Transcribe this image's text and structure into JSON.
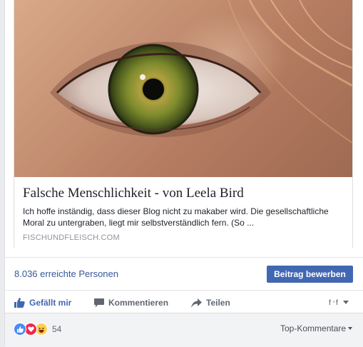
{
  "link_card": {
    "title": "Falsche Menschlichkeit - von Leela Bird",
    "description": "Ich hoffe inständig, dass dieser Blog nicht zu makaber wird. Die gesellschaftliche Moral zu untergraben, liegt mir selbstverständlich fern. (So ...",
    "domain": "FISCHUNDFLEISCH.COM"
  },
  "reach": {
    "text": "8.036 erreichte Personen",
    "boost_label": "Beitrag bewerben"
  },
  "actions": {
    "like_label": "Gefällt mir",
    "comment_label": "Kommentieren",
    "share_label": "Teilen"
  },
  "reactions": {
    "count": "54",
    "icons": [
      "like-icon",
      "love-icon",
      "haha-icon"
    ]
  },
  "comments": {
    "sort_label": "Top-Kommentare"
  },
  "colors": {
    "link_blue": "#385898",
    "button_blue": "#4267b2",
    "background": "#e9ebee"
  }
}
